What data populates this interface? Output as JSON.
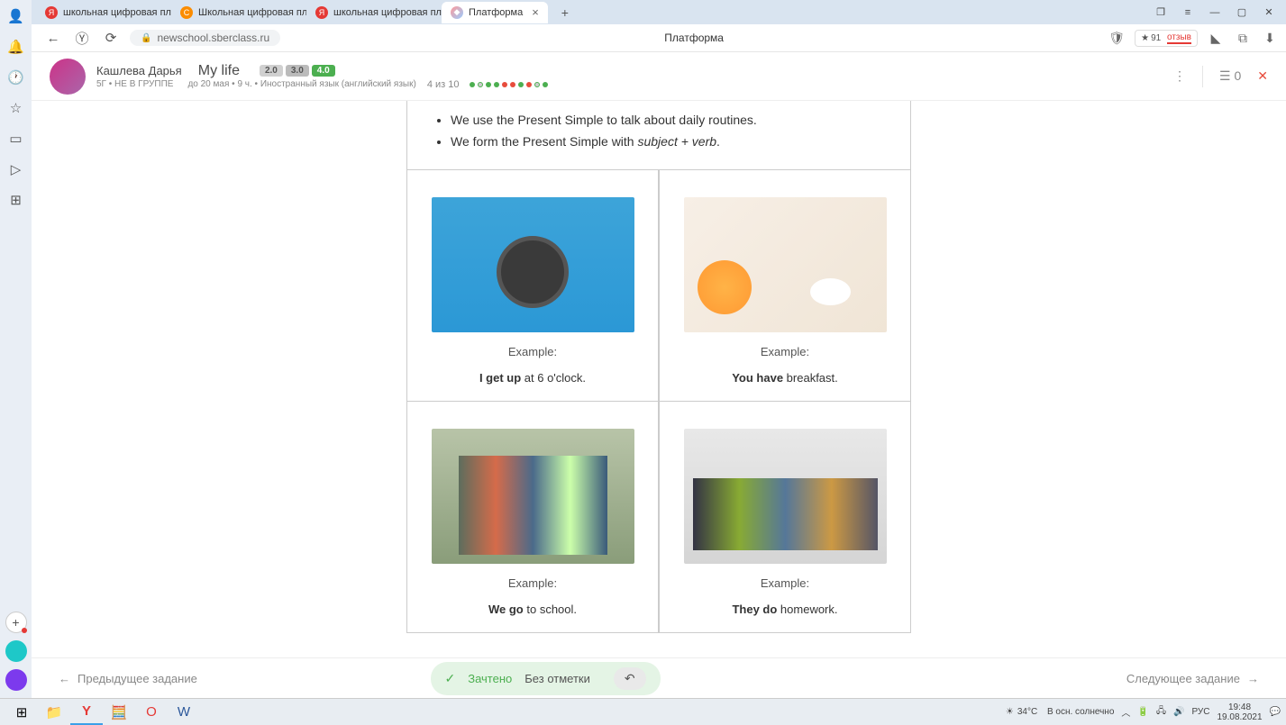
{
  "browser": {
    "tabs": [
      {
        "label": "школьная цифровая плат",
        "favicon": "red"
      },
      {
        "label": "Школьная цифровая плат",
        "favicon": "orange"
      },
      {
        "label": "школьная цифровая плат",
        "favicon": "red"
      },
      {
        "label": "Платформа",
        "favicon": "multi",
        "active": true
      }
    ],
    "url": "newschool.sberclass.ru",
    "page_title": "Платформа",
    "reviews_count": "91",
    "reviews_word": "отзыв"
  },
  "app": {
    "user_name": "Кашлева Дарья",
    "user_class": "5Г",
    "user_group": "НЕ В ГРУППЕ",
    "lesson_title": "My life",
    "due": "до 20 мая",
    "duration": "9 ч.",
    "subject": "Иностранный язык (английский язык)",
    "badges": [
      "2.0",
      "3.0",
      "4.0"
    ],
    "progress": "4 из 10",
    "dots": [
      "g",
      "o",
      "g",
      "g",
      "r",
      "r",
      "g",
      "r",
      "o",
      "g"
    ],
    "header_count": "0"
  },
  "content": {
    "rule1": "We use the Present Simple to talk about daily routines.",
    "rule2_a": "We form the Present Simple with ",
    "rule2_b": "subject + verb",
    "rule2_c": ".",
    "cells": [
      {
        "example": "Example:",
        "bold": "I get up",
        "rest": " at 6 o'clock."
      },
      {
        "example": "Example:",
        "bold": "You have",
        "rest": " breakfast."
      },
      {
        "example": "Example:",
        "bold": "We go",
        "rest": " to school."
      },
      {
        "example": "Example:",
        "bold": "They do",
        "rest": " homework."
      }
    ]
  },
  "footer": {
    "prev": "Предыдущее задание",
    "next": "Следующее задание",
    "status": "Зачтено",
    "note": "Без отметки"
  },
  "taskbar": {
    "temp": "34°C",
    "weather": "В осн. солнечно",
    "lang": "РУС",
    "time": "19:48",
    "date": "19.08.2021"
  }
}
